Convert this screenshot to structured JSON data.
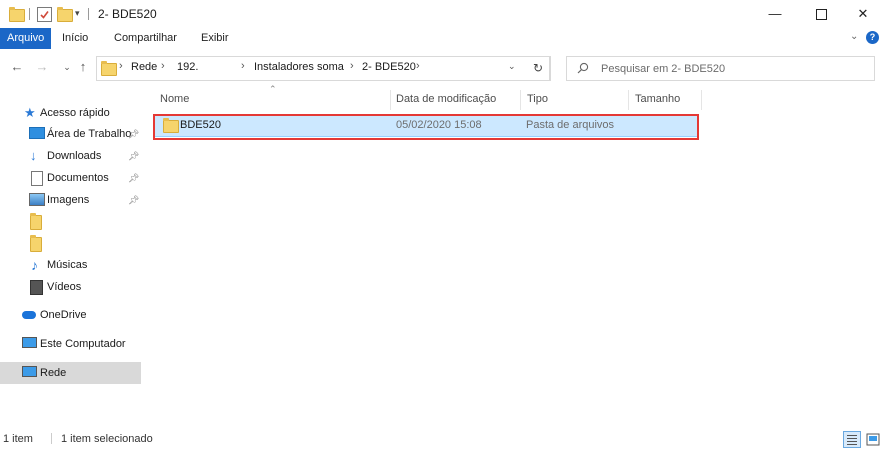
{
  "window": {
    "title": "2- BDE520",
    "minimize_icon": "minimize-icon",
    "maximize_icon": "maximize-icon",
    "close_icon": "close-icon"
  },
  "quick_access": {
    "icons": [
      "folder-icon",
      "properties-check-icon",
      "new-folder-icon",
      "customize-dropdown-icon"
    ]
  },
  "ribbon": {
    "tabs": [
      "Arquivo",
      "Início",
      "Compartilhar",
      "Exibir"
    ],
    "active_tab": "Arquivo",
    "accent_color": "#1b67c7"
  },
  "address": {
    "crumbs": [
      "Rede",
      "192.",
      "Instaladores soma",
      "2- BDE520"
    ],
    "search_placeholder": "Pesquisar em 2- BDE520"
  },
  "nav": {
    "items": [
      {
        "label": "Acesso rápido",
        "icon": "star-icon",
        "pinned": false
      },
      {
        "label": "Área de Trabalho",
        "icon": "desktop-icon",
        "pinned": true
      },
      {
        "label": "Downloads",
        "icon": "download-arrow-icon",
        "pinned": true
      },
      {
        "label": "Documentos",
        "icon": "documents-icon",
        "pinned": true
      },
      {
        "label": "Imagens",
        "icon": "pictures-icon",
        "pinned": true
      },
      {
        "label": "",
        "icon": "folder-icon",
        "pinned": false
      },
      {
        "label": "",
        "icon": "folder-icon",
        "pinned": false
      },
      {
        "label": "Músicas",
        "icon": "music-note-icon",
        "pinned": false
      },
      {
        "label": "Vídeos",
        "icon": "video-icon",
        "pinned": false
      },
      {
        "label": "OneDrive",
        "icon": "cloud-icon",
        "pinned": false
      },
      {
        "label": "Este Computador",
        "icon": "computer-icon",
        "pinned": false
      },
      {
        "label": "Rede",
        "icon": "network-icon",
        "pinned": false,
        "selected": true
      }
    ]
  },
  "columns": [
    "Nome",
    "Data de modificação",
    "Tipo",
    "Tamanho"
  ],
  "files": [
    {
      "name": "BDE520",
      "modified": "05/02/2020 15:08",
      "type": "Pasta de arquivos",
      "size": "",
      "selected": true
    }
  ],
  "status": {
    "count": "1 item",
    "selected": "1 item selecionado"
  }
}
